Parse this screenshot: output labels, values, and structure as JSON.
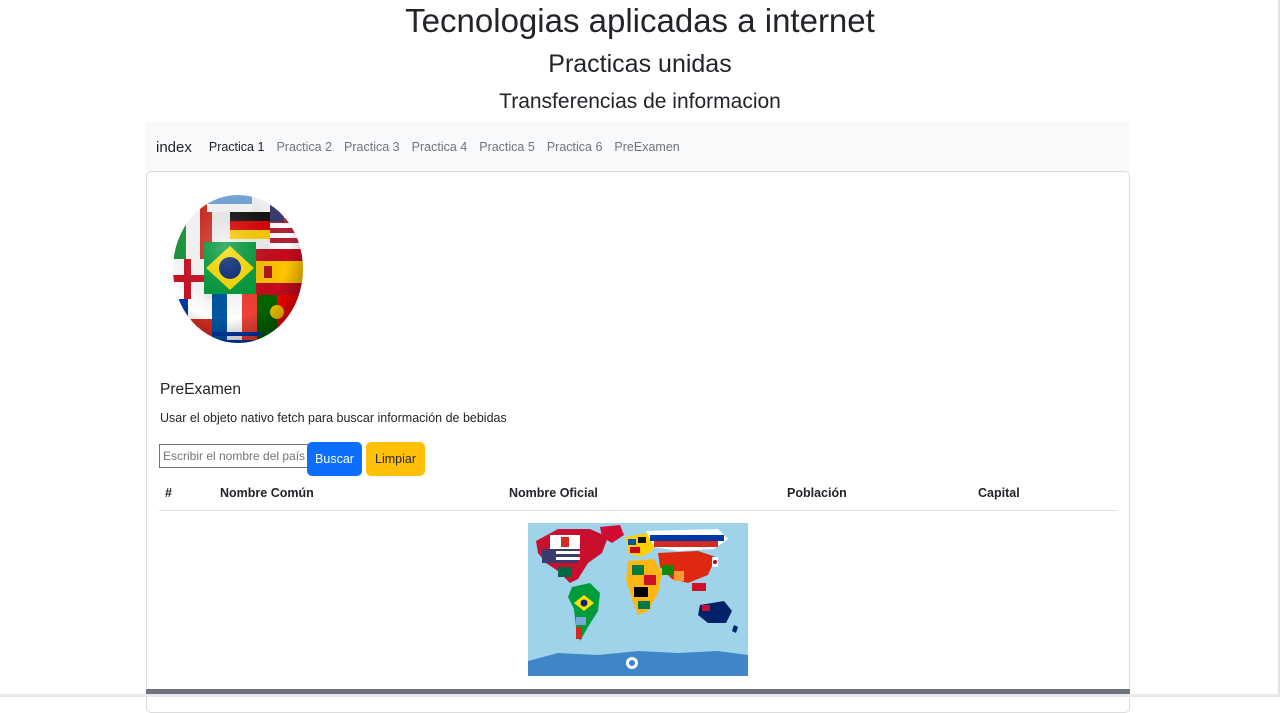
{
  "header": {
    "title": "Tecnologias aplicadas a internet",
    "subtitle": "Practicas unidas",
    "section": "Transferencias de informacion"
  },
  "navbar": {
    "brand": "index",
    "links": [
      {
        "label": "Practica 1",
        "active": true
      },
      {
        "label": "Practica 2",
        "active": false
      },
      {
        "label": "Practica 3",
        "active": false
      },
      {
        "label": "Practica 4",
        "active": false
      },
      {
        "label": "Practica 5",
        "active": false
      },
      {
        "label": "Practica 6",
        "active": false
      },
      {
        "label": "PreExamen",
        "active": false
      }
    ]
  },
  "main": {
    "image_ball": "soccer-ball-flags",
    "title": "PreExamen",
    "description": "Usar el objeto nativo fetch para buscar información de bebidas",
    "search": {
      "placeholder": "Escribir el nombre del país",
      "value": ""
    },
    "buttons": {
      "search": "Buscar",
      "clear": "Limpiar"
    },
    "table": {
      "headers": [
        "#",
        "Nombre Común",
        "Nombre Oficial",
        "Población",
        "Capital"
      ],
      "rows": []
    },
    "image_map": "world-map-flags"
  },
  "colors": {
    "primary": "#0d6efd",
    "warning": "#ffc107",
    "navbar_bg": "#f8f9fa",
    "footer": "#6c757d"
  }
}
